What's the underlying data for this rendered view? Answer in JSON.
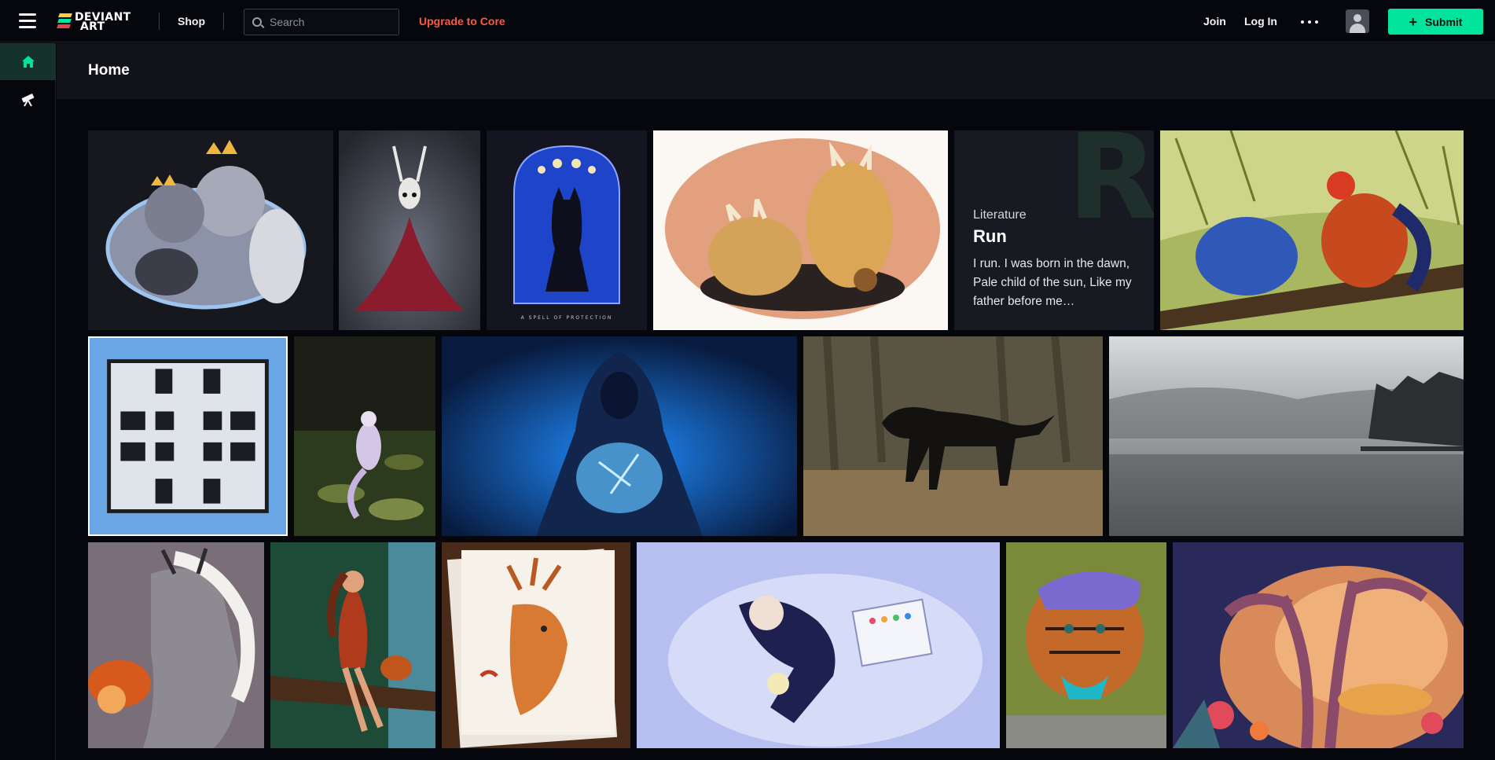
{
  "app": {
    "brand_line1": "DEVIANT",
    "brand_line2": "ART"
  },
  "topbar": {
    "shop_label": "Shop",
    "search_placeholder": "Search",
    "upgrade_label": "Upgrade to Core",
    "join_label": "Join",
    "login_label": "Log In",
    "submit_label": "Submit"
  },
  "sidebar": {
    "items": [
      {
        "icon": "home-icon",
        "active": true
      },
      {
        "icon": "telescope-icon",
        "active": false
      }
    ]
  },
  "header": {
    "title": "Home"
  },
  "gallery": {
    "literature": {
      "category": "Literature",
      "title": "Run",
      "excerpt": "I run. I was born in the dawn, Pale child of the sun, Like my father before me…"
    }
  },
  "colors": {
    "accent": "#00e59b",
    "upgrade": "#ff5a3c",
    "background": "#06070d"
  }
}
